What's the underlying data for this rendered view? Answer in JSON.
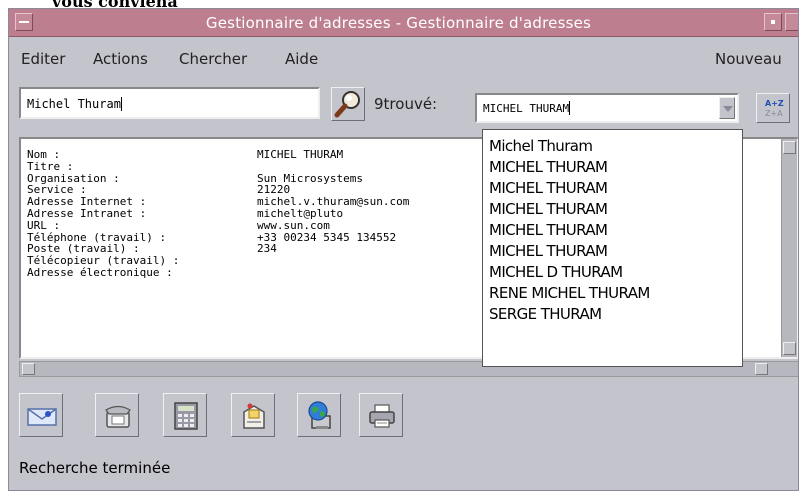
{
  "caption_above": "vous conviena",
  "window": {
    "title": "Gestionnaire d'adresses - Gestionnaire d'adresses",
    "title_bar_color": "#bd7f8f"
  },
  "menubar": {
    "items": [
      "Editer",
      "Actions",
      "Chercher",
      "Aide"
    ],
    "new_label": "Nouveau"
  },
  "search": {
    "name_value": "Michel Thuram",
    "found_label": "9trouvé:",
    "combo_value": "MICHEL THURAM"
  },
  "details": {
    "rows": [
      {
        "label": "Nom :",
        "value": "MICHEL THURAM"
      },
      {
        "label": "Titre :",
        "value": ""
      },
      {
        "label": "Organisation :",
        "value": "Sun Microsystems"
      },
      {
        "label": "Service :",
        "value": "21220"
      },
      {
        "label": "Adresse Internet :",
        "value": "michel.v.thuram@sun.com"
      },
      {
        "label": "Adresse Intranet :",
        "value": "michelt@pluto"
      },
      {
        "label": "URL :",
        "value": "www.sun.com"
      },
      {
        "label": "Téléphone (travail) :",
        "value": "+33 00234 5345 134552"
      },
      {
        "label": "Poste (travail) :",
        "value": "234"
      },
      {
        "label": "Télécopieur (travail) :",
        "value": ""
      },
      {
        "label": "Adresse électronique :",
        "value": ""
      }
    ]
  },
  "results": [
    "Michel Thuram",
    "MICHEL THURAM",
    "MICHEL THURAM",
    "MICHEL THURAM",
    "MICHEL THURAM",
    "MICHEL THURAM",
    "MICHEL D THURAM",
    "RENE MICHEL THURAM",
    "SERGE THURAM"
  ],
  "toolbar": {
    "icons": [
      "email-icon",
      "phone-icon",
      "calculator-icon",
      "address-card-icon",
      "globe-computer-icon",
      "printer-icon"
    ]
  },
  "status": "Recherche terminée"
}
